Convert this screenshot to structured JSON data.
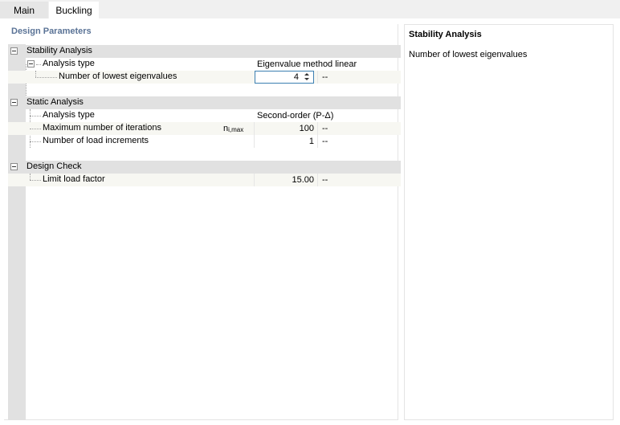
{
  "tabs": [
    {
      "label": "Main"
    },
    {
      "label": "Buckling"
    }
  ],
  "design_parameters": {
    "title": "Design Parameters",
    "stability_analysis": {
      "label": "Stability Analysis",
      "analysis_type": {
        "label": "Analysis type",
        "value": "Eigenvalue method linear"
      },
      "num_eigenvalues": {
        "label": "Number of lowest eigenvalues",
        "value": "4",
        "unit": "--"
      }
    },
    "static_analysis": {
      "label": "Static Analysis",
      "analysis_type": {
        "label": "Analysis type",
        "value": "Second-order (P-Δ)"
      },
      "max_iterations": {
        "label": "Maximum number of iterations",
        "symbol": "n",
        "symbol_sub": "i,max",
        "value": "100",
        "unit": "--"
      },
      "load_increments": {
        "label": "Number of load increments",
        "value": "1",
        "unit": "--"
      }
    },
    "design_check": {
      "label": "Design Check",
      "limit_load_factor": {
        "label": "Limit load factor",
        "value": "15.00",
        "unit": "--"
      }
    }
  },
  "info_panel": {
    "title": "Stability Analysis",
    "text": "Number of lowest eigenvalues"
  }
}
